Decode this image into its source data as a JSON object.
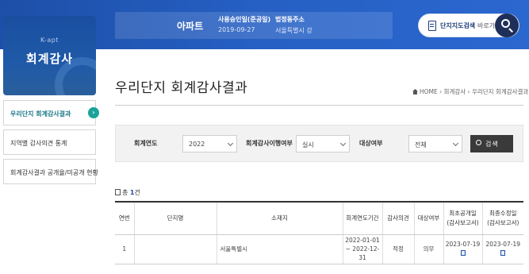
{
  "brand": {
    "en": "K-apt",
    "ko": "회계감사"
  },
  "apartment": {
    "title": "아파트",
    "approval_label": "사용승인일(준공일)",
    "approval_date": "2019-09-27",
    "address_label": "법정동주소",
    "address_value": "서울특별시 강"
  },
  "map_search": {
    "label": "단지지도검색",
    "sub": "바로가기"
  },
  "sidebar": {
    "items": [
      {
        "label": "우리단지 회계감사결과",
        "active": true,
        "chevron": "›"
      },
      {
        "label": "지역별 감사의견 통계"
      },
      {
        "label": "회계감사결과 공개율/미공개 현황"
      }
    ]
  },
  "page": {
    "title": "우리단지 회계감사결과"
  },
  "breadcrumb": {
    "home": "HOME",
    "sep": "›",
    "level1": "회계감사",
    "level2": "우리단지 회계감사결과"
  },
  "filter": {
    "year_label": "회계연도",
    "year_value": "2022",
    "audit_label": "회계감사이행여부",
    "audit_value": "실시",
    "target_label": "대상여부",
    "target_value": "전체",
    "search_label": "검색"
  },
  "count": {
    "prefix": "총",
    "value": "1",
    "suffix": "건"
  },
  "table": {
    "headers": {
      "no": "연번",
      "name": "단지명",
      "addr": "소재지",
      "period": "회계연도기간",
      "opinion": "감사의견",
      "target": "대상여부",
      "first_line1": "최초공개일",
      "first_line2": "(감사보고서)",
      "final_line1": "최종수정일",
      "final_line2": "(감사보고서)"
    },
    "rows": [
      {
        "no": "1",
        "name": "",
        "addr": "서울특별시",
        "period_start": "2022-01-01",
        "period_end": "~ 2022-12-31",
        "opinion": "적정",
        "target": "의무",
        "first_date": "2023-07-19",
        "final_date": "2023-07-19"
      }
    ]
  },
  "colors": {
    "banner": "#2660c4",
    "accent": "#1aa39a",
    "count_num": "#1f4fa8"
  },
  "icons": [
    "doc-icon",
    "search-icon",
    "chevron-right-icon",
    "home-icon",
    "list-icon",
    "file-icon"
  ]
}
